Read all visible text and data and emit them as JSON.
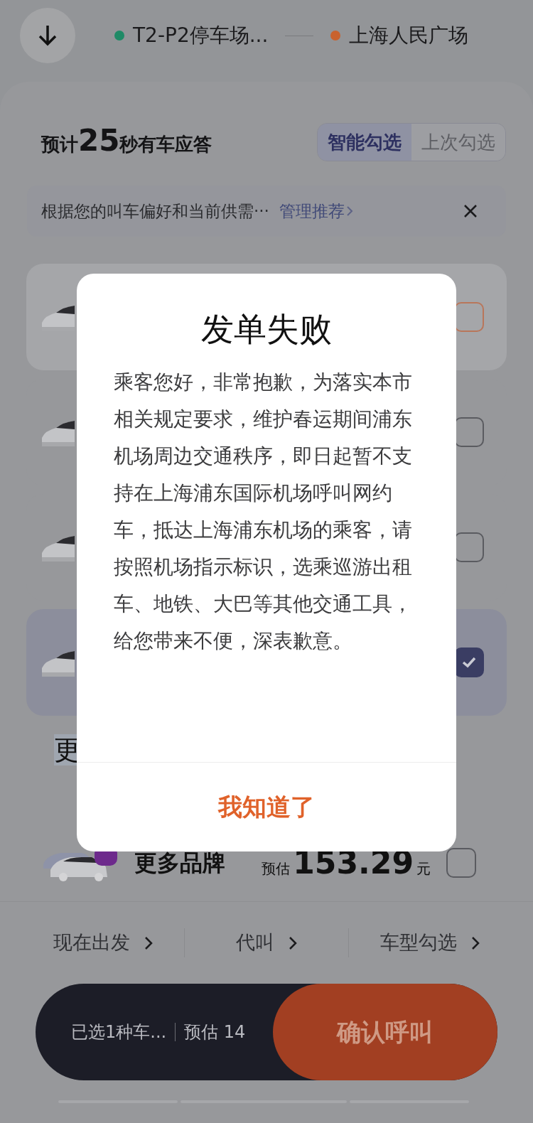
{
  "route": {
    "from": {
      "label": "T2-P2停车场...",
      "color": "#1f8a66"
    },
    "to": {
      "label": "上海人民广场",
      "color": "#c9622e"
    }
  },
  "header": {
    "prefix": "预计",
    "seconds": "25",
    "suffix": "秒有车应答"
  },
  "tabs": [
    {
      "label": "智能勾选",
      "selected": true
    },
    {
      "label": "上次勾选",
      "selected": false
    }
  ],
  "notice": {
    "text": "根据您的叫车偏好和当前供需···",
    "link": "管理推荐"
  },
  "car_rows": [
    {
      "card": true,
      "checked": false,
      "accent": true
    },
    {
      "card": false,
      "checked": false,
      "accent": false
    },
    {
      "card": false,
      "checked": false,
      "accent": false
    },
    {
      "card": true,
      "checked": true,
      "accent": false
    }
  ],
  "section_title": "更",
  "more_brands": {
    "name": "更多品牌",
    "estimate_label": "预估",
    "price": "153.29",
    "unit": "元",
    "checked": false
  },
  "options": [
    "现在出发",
    "代叫",
    "车型勾选"
  ],
  "bottom_bar": {
    "selected": "已选1种车...",
    "estimate": "预估 14",
    "confirm": "确认呼叫"
  },
  "dialog": {
    "title": "发单失败",
    "body": "乘客您好，非常抱歉，为落实本市相关规定要求，维护春运期间浦东机场周边交通秩序，即日起暂不支持在上海浦东国际机场呼叫网约车，抵达上海浦东机场的乘客，请按照机场指示标识，选乘巡游出租车、地铁、大巴等其他交通工具，给您带来不便，深表歉意。",
    "button": "我知道了"
  }
}
